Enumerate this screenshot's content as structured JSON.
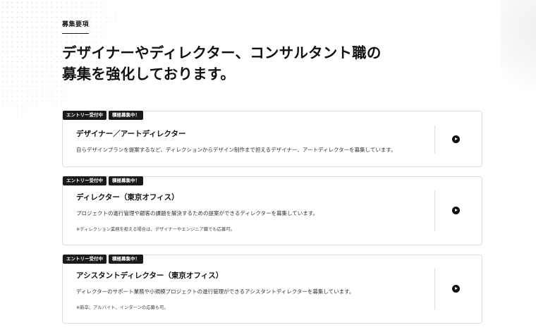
{
  "section": {
    "label": "募集要項"
  },
  "heading": {
    "line1": "デザイナーやディレクター、コンサルタント職の",
    "line2": "募集を強化しております。"
  },
  "jobs": [
    {
      "badges": [
        "エントリー受付中",
        "積極募集中！"
      ],
      "title": "デザイナー／アートディレクター",
      "description": "自らデザインプランを提案するなど、ディレクションからデザイン制作まで担えるデザイナー、アートディレクターを募集しています。",
      "note": "",
      "icon": "arrow-circle-right-icon"
    },
    {
      "badges": [
        "エントリー受付中",
        "積極募集中！"
      ],
      "title": "ディレクター（東京オフィス）",
      "description": "プロジェクトの進行管理や顧客の課題を解決するための提案ができるディレクターを募集しています。",
      "note": "※ディレクション業務を担える場合は、デザイナーやエンジニア職でも応募可。",
      "icon": "arrow-circle-right-icon"
    },
    {
      "badges": [
        "エントリー受付中",
        "積極募集中！"
      ],
      "title": "アシスタントディレクター（東京オフィス）",
      "description": "ディレクターのサポート業務や小規模プロジェクトの進行管理ができるアシスタントディレクターを募集しています。",
      "note": "※新卒、アルバイト、インターンの応募も可。",
      "icon": "arrow-circle-right-icon"
    }
  ]
}
